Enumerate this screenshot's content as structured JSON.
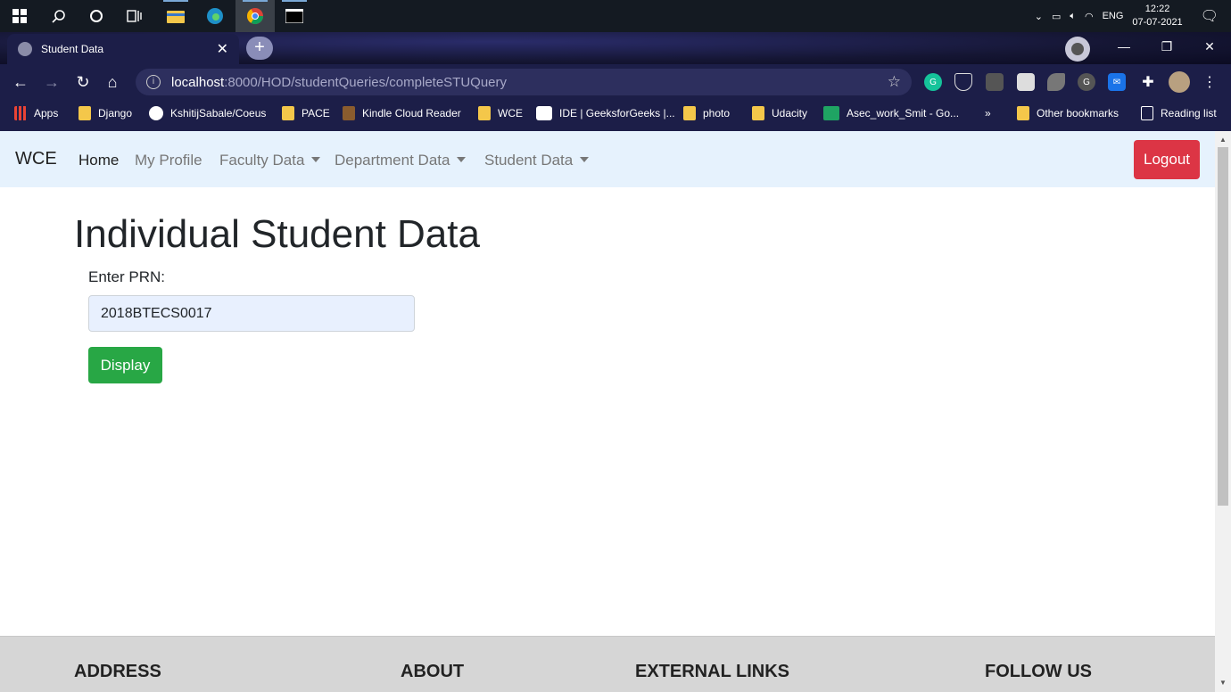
{
  "taskbar": {
    "tray": {
      "lang": "ENG",
      "time": "12:22",
      "date": "07-07-2021"
    }
  },
  "browser": {
    "tab_title": "Student Data",
    "url_host": "localhost",
    "url_path": ":8000/HOD/studentQueries/completeSTUQuery",
    "bookmarks": [
      {
        "label": "Apps",
        "icon": "apps-grid-icon"
      },
      {
        "label": "Django",
        "icon": "folder-icon"
      },
      {
        "label": "KshitijSabale/Coeus",
        "icon": "github-icon"
      },
      {
        "label": "PACE",
        "icon": "folder-icon"
      },
      {
        "label": "Kindle Cloud Reader",
        "icon": "kindle-icon"
      },
      {
        "label": "WCE",
        "icon": "folder-icon"
      },
      {
        "label": "IDE | GeeksforGeeks |...",
        "icon": "geeksforgeeks-icon"
      },
      {
        "label": "photo",
        "icon": "folder-icon"
      },
      {
        "label": "Udacity",
        "icon": "folder-icon"
      },
      {
        "label": "Asec_work_Smit - Go...",
        "icon": "sheets-icon"
      }
    ],
    "overflow": "»",
    "other_bookmarks": "Other bookmarks",
    "reading_list": "Reading list"
  },
  "navbar": {
    "brand": "WCE",
    "links": [
      {
        "label": "Home",
        "active": true
      },
      {
        "label": "My Profile",
        "active": false
      },
      {
        "label": "Faculty Data",
        "dropdown": true
      },
      {
        "label": "Department Data",
        "dropdown": true
      },
      {
        "label": "Student Data",
        "dropdown": true
      }
    ],
    "logout": "Logout"
  },
  "main": {
    "title": "Individual Student Data",
    "prn_label": "Enter PRN:",
    "prn_value": "2018BTECS0017",
    "display_button": "Display"
  },
  "footer": {
    "headings": [
      "ADDRESS",
      "ABOUT",
      "EXTERNAL LINKS",
      "FOLLOW US"
    ]
  },
  "colors": {
    "navbar_bg": "#e6f2fd",
    "logout": "#dc3545",
    "display": "#28a745",
    "footer_bg": "#d6d6d6"
  }
}
